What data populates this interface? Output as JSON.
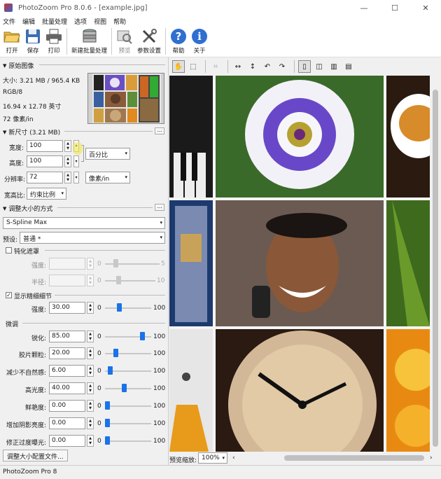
{
  "window": {
    "title": "PhotoZoom Pro 8.0.6 - [example.jpg]",
    "controls": [
      "—",
      "☐",
      "✕"
    ]
  },
  "menu": [
    "文件",
    "编辑",
    "批量处理",
    "选项",
    "视图",
    "帮助"
  ],
  "toolbar": {
    "open": "打开",
    "save": "保存",
    "print": "打印",
    "new_batch": "新建批量处理",
    "preview": "预览",
    "settings": "参数设置",
    "help": "帮助",
    "about": "关于"
  },
  "original_image": {
    "header": "原始图像",
    "size": "大小: 3.21 MB / 965.4 KB",
    "mode": "RGB/8",
    "dimensions": "16.94 x 12.78 英寸",
    "resolution": "72 像素/in"
  },
  "new_size": {
    "header": "新尺寸 (3.21 MB)",
    "width_label": "宽度:",
    "width_value": "100",
    "height_label": "高度:",
    "height_value": "100",
    "unit": "百分比",
    "resolution_label": "分辨率:",
    "resolution_value": "72",
    "resolution_unit": "像素/in",
    "aspect_label": "宽高比:",
    "aspect_value": "约束比例"
  },
  "resize_method": {
    "header": "调整大小的方式",
    "method": "S-Spline Max",
    "preset_label": "预设:",
    "preset_value": "普通 *"
  },
  "unsharp": {
    "label": "钝化遮罩",
    "checked": false,
    "strength_label": "强度:",
    "strength_min": "0",
    "strength_max": "5",
    "radius_label": "半径:",
    "radius_min": "0",
    "radius_max": "10"
  },
  "detail": {
    "label": "显示精细细节",
    "checked": true,
    "strength_label": "强度:",
    "strength_value": "30.00",
    "min": "0",
    "max": "100"
  },
  "fine_tune": {
    "header": "微调",
    "rows": [
      {
        "label": "锐化:",
        "value": "85.00",
        "min": "0",
        "max": "100",
        "level": 0.85
      },
      {
        "label": "胶片颗粒:",
        "value": "20.00",
        "min": "0",
        "max": "100",
        "level": 0.2
      },
      {
        "label": "减少不自然感:",
        "value": "6.00",
        "min": "0",
        "max": "100",
        "level": 0.06
      },
      {
        "label": "高光度:",
        "value": "40.00",
        "min": "0",
        "max": "100",
        "level": 0.4
      },
      {
        "label": "鲜艳度:",
        "value": "0.00",
        "min": "0",
        "max": "100",
        "level": 0.0
      },
      {
        "label": "增加阴影亮度:",
        "value": "0.00",
        "min": "0",
        "max": "100",
        "level": 0.0
      },
      {
        "label": "修正过度曝光:",
        "value": "0.00",
        "min": "0",
        "max": "100",
        "level": 0.0
      }
    ]
  },
  "config_button": "调整大小配置文件...",
  "preview_zoom": {
    "label": "预览缩放:",
    "value": "100%"
  },
  "status": "PhotoZoom Pro 8"
}
